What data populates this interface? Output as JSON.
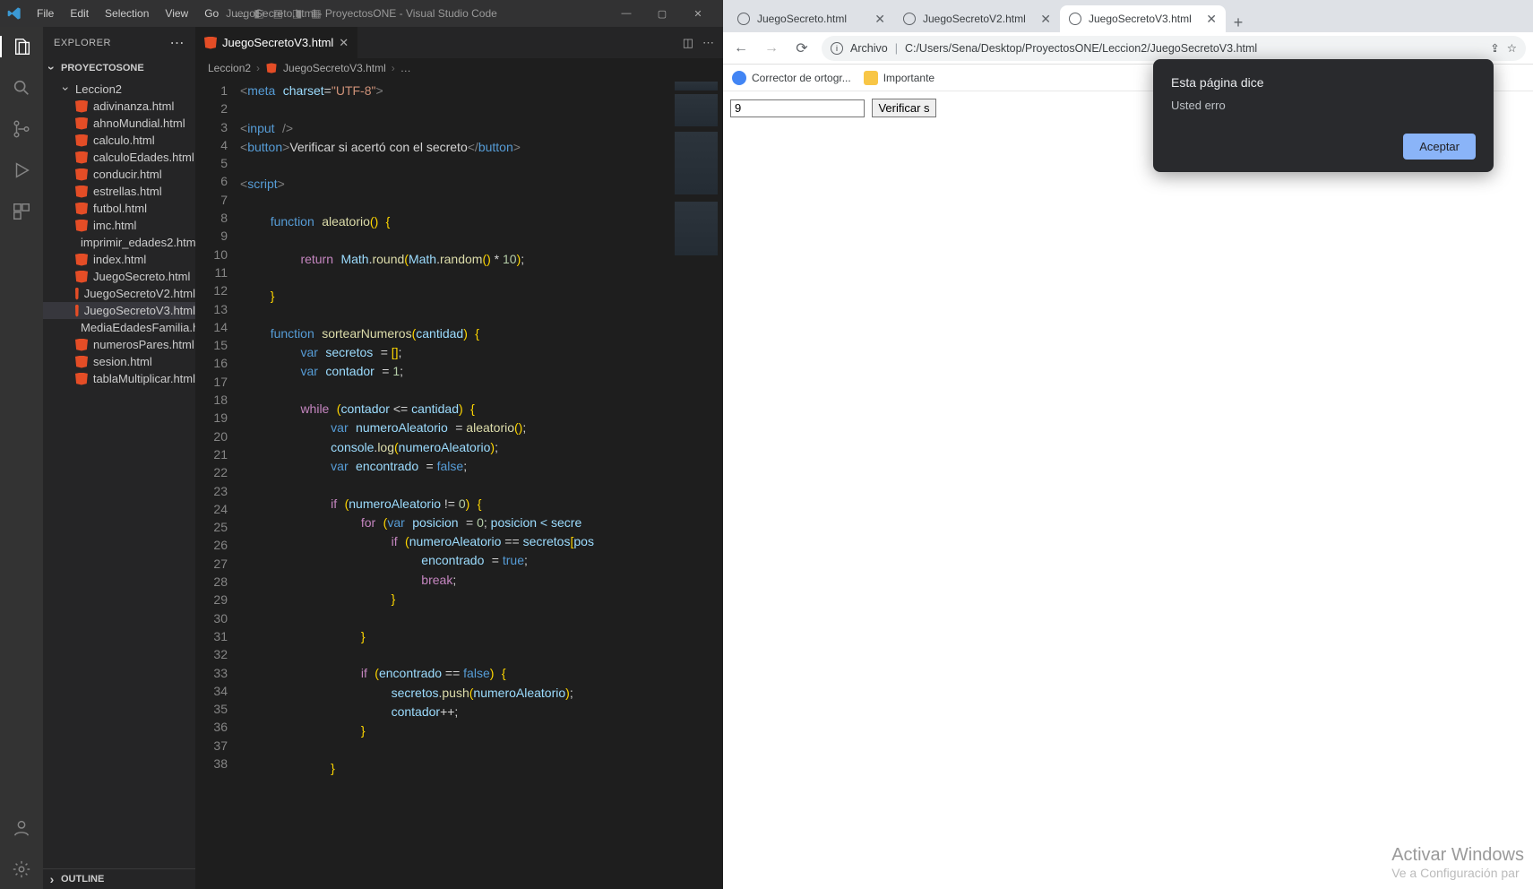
{
  "vscode": {
    "menus": [
      "File",
      "Edit",
      "Selection",
      "View",
      "Go",
      "…"
    ],
    "title": "JuegoSecreto.html - ProyectosONE - Visual Studio Code",
    "explorer_label": "EXPLORER",
    "project_name": "PROYECTOSONE",
    "folder_name": "Leccion2",
    "files": [
      "adivinanza.html",
      "ahnoMundial.html",
      "calculo.html",
      "calculoEdades.html",
      "conducir.html",
      "estrellas.html",
      "futbol.html",
      "imc.html",
      "imprimir_edades2.html",
      "index.html",
      "JuegoSecreto.html",
      "JuegoSecretoV2.html",
      "JuegoSecretoV3.html",
      "MediaEdadesFamilia.html",
      "numerosPares.html",
      "sesion.html",
      "tablaMultiplicar.html"
    ],
    "selected_file": "JuegoSecretoV3.html",
    "outline_label": "OUTLINE",
    "open_tab": {
      "label": "JuegoSecretoV3.html"
    },
    "breadcrumb": [
      "Leccion2",
      "JuegoSecretoV3.html",
      "…"
    ],
    "line_numbers": [
      1,
      2,
      3,
      4,
      5,
      6,
      7,
      8,
      9,
      10,
      11,
      12,
      13,
      14,
      15,
      16,
      17,
      18,
      19,
      20,
      21,
      22,
      23,
      24,
      25,
      26,
      27,
      28,
      29,
      30,
      31,
      32,
      33,
      34,
      35,
      36,
      37,
      38
    ],
    "code": {
      "l1": {
        "meta": "meta",
        "charset_attr": "charset",
        "charset_val": "\"UTF-8\""
      },
      "l3": {
        "tag": "input"
      },
      "l4": {
        "btn_open": "button",
        "btn_text": "Verificar si acertó con el secreto",
        "btn_close": "button"
      },
      "l6": {
        "tag": "script"
      },
      "l8": {
        "kw": "function",
        "name": "aleatorio"
      },
      "l10": {
        "ret": "return",
        "math1": "Math",
        "round": "round",
        "math2": "Math",
        "random": "random",
        "mul": " * ",
        "ten": "10"
      },
      "l14": {
        "kw": "function",
        "name": "sortearNumeros",
        "param": "cantidad"
      },
      "l15": {
        "var": "var",
        "name": "secretos"
      },
      "l16": {
        "var": "var",
        "name": "contador",
        "one": "1"
      },
      "l18": {
        "while": "while",
        "cond_l": "contador",
        "op": " <= ",
        "cond_r": "cantidad"
      },
      "l19": {
        "var": "var",
        "name": "numeroAleatorio",
        "call": "aleatorio"
      },
      "l20": {
        "console": "console",
        "log": "log",
        "arg": "numeroAleatorio"
      },
      "l21": {
        "var": "var",
        "name": "encontrado",
        "val": "false"
      },
      "l23": {
        "if": "if",
        "a": "numeroAleatorio",
        "op": " != ",
        "b": "0"
      },
      "l24": {
        "for": "for",
        "var": "var",
        "p": "posicion",
        "z": "0",
        "cond": "posicion < secre"
      },
      "l25": {
        "if": "if",
        "a": "numeroAleatorio",
        "op": " == ",
        "b": "secretos",
        "idx": "pos"
      },
      "l26": {
        "a": "encontrado",
        "v": "true"
      },
      "l27": {
        "brk": "break"
      },
      "l32": {
        "if": "if",
        "a": "encontrado",
        "op": " == ",
        "b": "false"
      },
      "l33": {
        "a": "secretos",
        "push": "push",
        "arg": "numeroAleatorio"
      },
      "l34": {
        "a": "contador"
      }
    }
  },
  "browser": {
    "tabs": [
      {
        "label": "JuegoSecreto.html",
        "active": false
      },
      {
        "label": "JuegoSecretoV2.html",
        "active": false
      },
      {
        "label": "JuegoSecretoV3.html",
        "active": true
      }
    ],
    "url_label": "Archivo",
    "url": "C:/Users/Sena/Desktop/ProyectosONE/Leccion2/JuegoSecretoV3.html",
    "bookmarks": [
      {
        "label": "Corrector de ortogr...",
        "color": "#4285f4"
      },
      {
        "label": "Importante",
        "color": "#f8c646"
      }
    ],
    "page": {
      "input_value": "9",
      "button_label": "Verificar s"
    },
    "dialog": {
      "title": "Esta página dice",
      "message": "Usted erro",
      "ok": "Aceptar"
    },
    "watermark": {
      "line1": "Activar Windows",
      "line2": "Ve a Configuración par"
    }
  }
}
